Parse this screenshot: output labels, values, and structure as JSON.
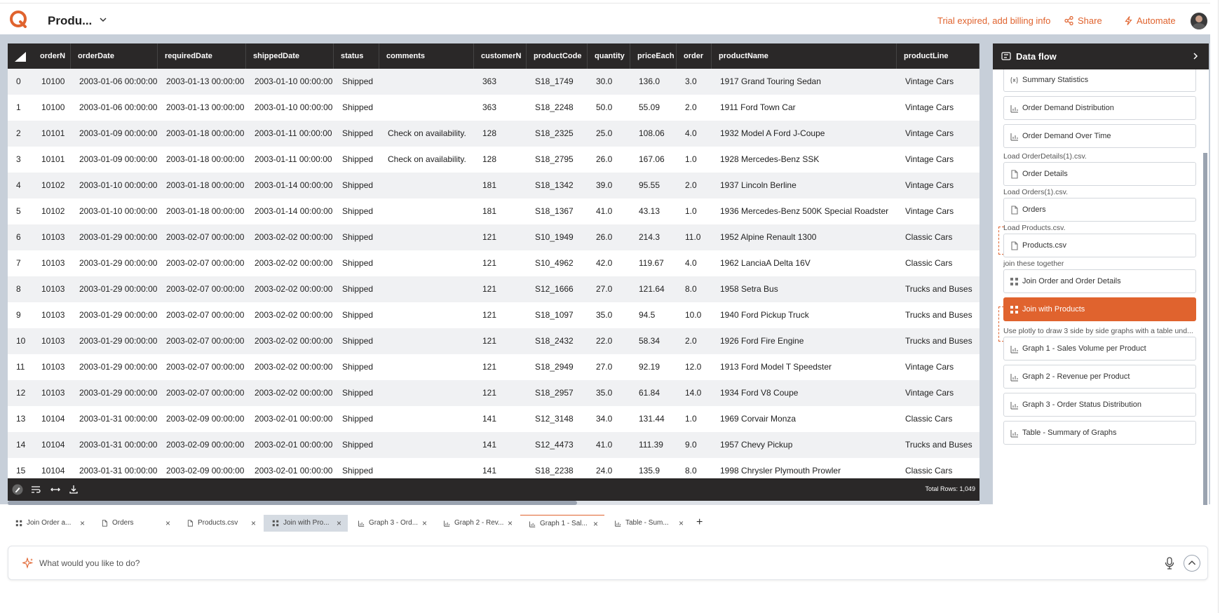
{
  "header": {
    "title": "Produ...",
    "trial_text": "Trial expired, add billing info",
    "share_label": "Share",
    "automate_label": "Automate",
    "accent_color": "#e0632e"
  },
  "table": {
    "columns": [
      "orderN",
      "orderDate",
      "requiredDate",
      "shippedDate",
      "status",
      "comments",
      "customerN",
      "productCode",
      "quantity",
      "priceEach",
      "order",
      "productName",
      "productLine"
    ],
    "rows": [
      [
        "0",
        "10100",
        "2003-01-06 00:00:00",
        "2003-01-13 00:00:00",
        "2003-01-10 00:00:00",
        "Shipped",
        "",
        "363",
        "S18_1749",
        "30.0",
        "136.0",
        "3.0",
        "1917 Grand Touring Sedan",
        "Vintage Cars"
      ],
      [
        "1",
        "10100",
        "2003-01-06 00:00:00",
        "2003-01-13 00:00:00",
        "2003-01-10 00:00:00",
        "Shipped",
        "",
        "363",
        "S18_2248",
        "50.0",
        "55.09",
        "2.0",
        "1911 Ford Town Car",
        "Vintage Cars"
      ],
      [
        "2",
        "10101",
        "2003-01-09 00:00:00",
        "2003-01-18 00:00:00",
        "2003-01-11 00:00:00",
        "Shipped",
        "Check on availability.",
        "128",
        "S18_2325",
        "25.0",
        "108.06",
        "4.0",
        "1932 Model A Ford J-Coupe",
        "Vintage Cars"
      ],
      [
        "3",
        "10101",
        "2003-01-09 00:00:00",
        "2003-01-18 00:00:00",
        "2003-01-11 00:00:00",
        "Shipped",
        "Check on availability.",
        "128",
        "S18_2795",
        "26.0",
        "167.06",
        "1.0",
        "1928 Mercedes-Benz SSK",
        "Vintage Cars"
      ],
      [
        "4",
        "10102",
        "2003-01-10 00:00:00",
        "2003-01-18 00:00:00",
        "2003-01-14 00:00:00",
        "Shipped",
        "",
        "181",
        "S18_1342",
        "39.0",
        "95.55",
        "2.0",
        "1937 Lincoln Berline",
        "Vintage Cars"
      ],
      [
        "5",
        "10102",
        "2003-01-10 00:00:00",
        "2003-01-18 00:00:00",
        "2003-01-14 00:00:00",
        "Shipped",
        "",
        "181",
        "S18_1367",
        "41.0",
        "43.13",
        "1.0",
        "1936 Mercedes-Benz 500K Special Roadster",
        "Vintage Cars"
      ],
      [
        "6",
        "10103",
        "2003-01-29 00:00:00",
        "2003-02-07 00:00:00",
        "2003-02-02 00:00:00",
        "Shipped",
        "",
        "121",
        "S10_1949",
        "26.0",
        "214.3",
        "11.0",
        "1952 Alpine Renault 1300",
        "Classic Cars"
      ],
      [
        "7",
        "10103",
        "2003-01-29 00:00:00",
        "2003-02-07 00:00:00",
        "2003-02-02 00:00:00",
        "Shipped",
        "",
        "121",
        "S10_4962",
        "42.0",
        "119.67",
        "4.0",
        "1962 LanciaA Delta 16V",
        "Classic Cars"
      ],
      [
        "8",
        "10103",
        "2003-01-29 00:00:00",
        "2003-02-07 00:00:00",
        "2003-02-02 00:00:00",
        "Shipped",
        "",
        "121",
        "S12_1666",
        "27.0",
        "121.64",
        "8.0",
        "1958 Setra Bus",
        "Trucks and Buses"
      ],
      [
        "9",
        "10103",
        "2003-01-29 00:00:00",
        "2003-02-07 00:00:00",
        "2003-02-02 00:00:00",
        "Shipped",
        "",
        "121",
        "S18_1097",
        "35.0",
        "94.5",
        "10.0",
        "1940 Ford Pickup Truck",
        "Trucks and Buses"
      ],
      [
        "10",
        "10103",
        "2003-01-29 00:00:00",
        "2003-02-07 00:00:00",
        "2003-02-02 00:00:00",
        "Shipped",
        "",
        "121",
        "S18_2432",
        "22.0",
        "58.34",
        "2.0",
        "1926 Ford Fire Engine",
        "Trucks and Buses"
      ],
      [
        "11",
        "10103",
        "2003-01-29 00:00:00",
        "2003-02-07 00:00:00",
        "2003-02-02 00:00:00",
        "Shipped",
        "",
        "121",
        "S18_2949",
        "27.0",
        "92.19",
        "12.0",
        "1913 Ford Model T Speedster",
        "Vintage Cars"
      ],
      [
        "12",
        "10103",
        "2003-01-29 00:00:00",
        "2003-02-07 00:00:00",
        "2003-02-02 00:00:00",
        "Shipped",
        "",
        "121",
        "S18_2957",
        "35.0",
        "61.84",
        "14.0",
        "1934 Ford V8 Coupe",
        "Vintage Cars"
      ],
      [
        "13",
        "10104",
        "2003-01-31 00:00:00",
        "2003-02-09 00:00:00",
        "2003-02-01 00:00:00",
        "Shipped",
        "",
        "141",
        "S12_3148",
        "34.0",
        "131.44",
        "1.0",
        "1969 Corvair Monza",
        "Classic Cars"
      ],
      [
        "14",
        "10104",
        "2003-01-31 00:00:00",
        "2003-02-09 00:00:00",
        "2003-02-01 00:00:00",
        "Shipped",
        "",
        "141",
        "S12_4473",
        "41.0",
        "111.39",
        "9.0",
        "1957 Chevy Pickup",
        "Trucks and Buses"
      ],
      [
        "15",
        "10104",
        "2003-01-31 00:00:00",
        "2003-02-09 00:00:00",
        "2003-02-01 00:00:00",
        "Shipped",
        "",
        "141",
        "S18_2238",
        "24.0",
        "135.9",
        "8.0",
        "1998 Chrysler Plymouth Prowler",
        "Classic Cars"
      ]
    ],
    "total_rows": "Total Rows: 1,049"
  },
  "dataflow": {
    "title": "Data flow",
    "items": [
      {
        "kind": "card",
        "label": "Summary Statistics",
        "icon": "variable-icon"
      },
      {
        "kind": "card",
        "label": "Order Demand Distribution",
        "icon": "chart-icon"
      },
      {
        "kind": "card",
        "label": "Order Demand Over Time",
        "icon": "chart-icon"
      },
      {
        "kind": "note",
        "label": "Load OrderDetails(1).csv."
      },
      {
        "kind": "card",
        "label": "Order Details",
        "icon": "file-icon"
      },
      {
        "kind": "note",
        "label": "Load Orders(1).csv."
      },
      {
        "kind": "card",
        "label": "Orders",
        "icon": "file-icon"
      },
      {
        "kind": "note",
        "label": "Load Products.csv."
      },
      {
        "kind": "card",
        "label": "Products.csv",
        "icon": "file-icon"
      },
      {
        "kind": "note",
        "label": "join these together"
      },
      {
        "kind": "card",
        "label": "Join Order and Order Details",
        "icon": "join-icon"
      },
      {
        "kind": "card",
        "label": "Join with Products",
        "icon": "join-icon",
        "active": true
      },
      {
        "kind": "note",
        "label": "Use plotly to draw 3 side by side graphs with a table und..."
      },
      {
        "kind": "card",
        "label": "Graph 1 - Sales Volume per Product",
        "icon": "chart-icon"
      },
      {
        "kind": "card",
        "label": "Graph 2 - Revenue per Product",
        "icon": "chart-icon"
      },
      {
        "kind": "card",
        "label": "Graph 3 - Order Status Distribution",
        "icon": "chart-icon"
      },
      {
        "kind": "card",
        "label": "Table - Summary of Graphs",
        "icon": "chart-icon"
      }
    ]
  },
  "tabs": [
    {
      "label": "Join Order a...",
      "icon": "join-icon"
    },
    {
      "label": "Orders",
      "icon": "file-icon"
    },
    {
      "label": "Products.csv",
      "icon": "file-icon"
    },
    {
      "label": "Join with Pro...",
      "icon": "join-icon",
      "active": true
    },
    {
      "label": "Graph 3 - Ord...",
      "icon": "chart-icon"
    },
    {
      "label": "Graph 2 - Rev...",
      "icon": "chart-icon"
    },
    {
      "label": "Graph 1 - Sal...",
      "icon": "chart-icon",
      "marked": true
    },
    {
      "label": "Table - Sum...",
      "icon": "chart-icon"
    }
  ],
  "prompt": {
    "placeholder": "What would you like to do?"
  }
}
